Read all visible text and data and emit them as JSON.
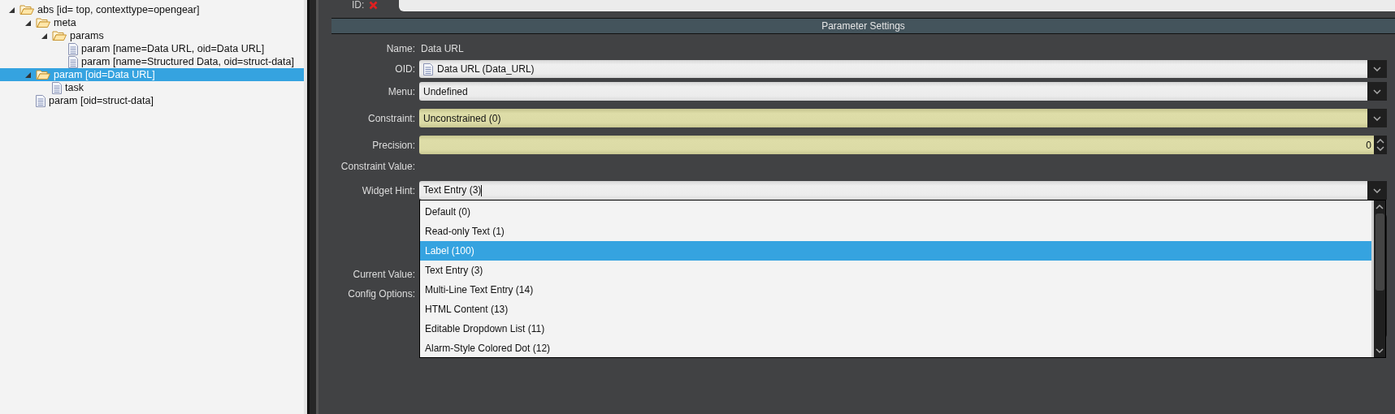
{
  "tree": [
    {
      "label": "abs [id=  top, contexttype=opengear]",
      "expanded": true,
      "selected": false,
      "children": [
        {
          "label": "meta",
          "expanded": true,
          "selected": false,
          "children": [
            {
              "label": "params",
              "expanded": true,
              "selected": false,
              "children": [
                {
                  "label": "param [name=Data URL, oid=Data  URL]",
                  "selected": false
                },
                {
                  "label": "param [name=Structured Data, oid=struct-data]",
                  "selected": false
                }
              ]
            }
          ]
        },
        {
          "label": "param [oid=Data  URL]",
          "expanded": true,
          "selected": true,
          "children": [
            {
              "label": "task",
              "selected": false
            }
          ]
        },
        {
          "label": "param [oid=struct-data]",
          "selected": false
        }
      ]
    }
  ],
  "id_field": {
    "label": "ID:",
    "error": true
  },
  "section_title": "Parameter Settings",
  "fields": [
    {
      "kind": "text",
      "label": "Name:",
      "value": "Data URL"
    },
    {
      "kind": "object-dropdown",
      "label": "OID:",
      "value": "Data URL (Data_URL)",
      "highlighted": false
    },
    {
      "kind": "dropdown",
      "label": "Menu:",
      "value": "Undefined",
      "highlighted": false
    },
    {
      "kind": "dropdown",
      "label": "Constraint:",
      "value": "Unconstrained (0)",
      "highlighted": true
    },
    {
      "kind": "spinner",
      "label": "Precision:",
      "value": "0",
      "highlighted": true
    },
    {
      "kind": "text",
      "label": "Constraint Value:"
    },
    {
      "kind": "combo",
      "label": "Widget Hint:",
      "value": "Text Entry (3)",
      "highlighted": false,
      "open": true
    },
    {
      "kind": "text",
      "label": "Current Value:"
    },
    {
      "kind": "box",
      "label": "Config Options:"
    }
  ],
  "widget_hint_options": [
    {
      "label": "Default (0)",
      "selected": false
    },
    {
      "label": "Read-only Text (1)",
      "selected": false
    },
    {
      "label": "Label (100)",
      "selected": true
    },
    {
      "label": "Text Entry (3)",
      "selected": false
    },
    {
      "label": "Multi-Line Text Entry (14)",
      "selected": false
    },
    {
      "label": "HTML Content (13)",
      "selected": false
    },
    {
      "label": "Editable Dropdown List (11)",
      "selected": false
    },
    {
      "label": "Alarm-Style Colored Dot (12)",
      "selected": false
    }
  ]
}
